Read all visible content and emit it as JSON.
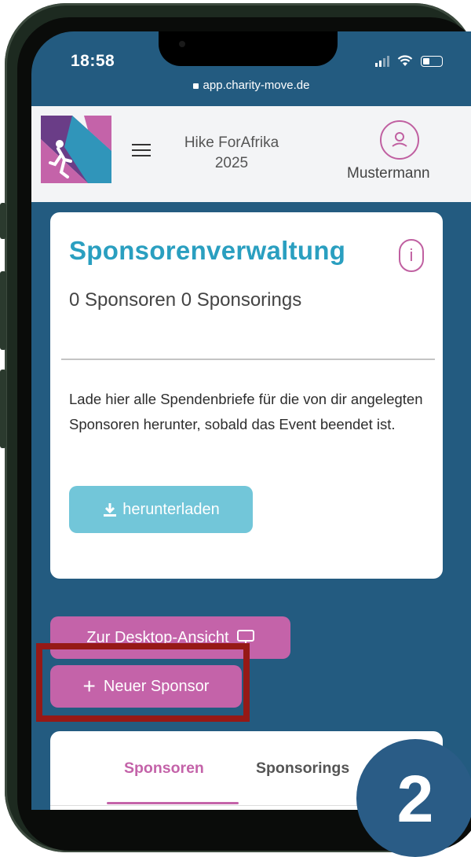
{
  "status_bar": {
    "time": "18:58"
  },
  "url_bar": {
    "url": "app.charity-move.de"
  },
  "header": {
    "event_title_line1": "Hike ForAfrika",
    "event_title_line2": "2025",
    "user_name": "Mustermann"
  },
  "card": {
    "title": "Sponsorenverwaltung",
    "info_icon_text": "i",
    "subtitle": "0 Sponsoren 0 Sponsorings",
    "description": "Lade hier alle Spendenbriefe für die von dir angelegten Sponsoren herunter, sobald das Event beendet ist.",
    "download_label": "herunterladen"
  },
  "actions": {
    "desktop_view_label": "Zur Desktop-Ansicht",
    "new_sponsor_label": "Neuer Sponsor",
    "new_sponsor_plus": "+"
  },
  "tabs": [
    {
      "label": "Sponsoren",
      "active": true
    },
    {
      "label": "Sponsorings",
      "active": false
    }
  ],
  "annotation": {
    "step_number": "2"
  },
  "colors": {
    "primary_pink": "#c463a9",
    "primary_blue": "#2a9fc0",
    "background_blue": "#235b80",
    "download_button": "#72c6d9",
    "highlight_red": "#961916"
  },
  "icons": [
    "lock-icon",
    "hamburger-icon",
    "user-icon",
    "info-icon",
    "download-icon",
    "monitor-icon",
    "plus-icon"
  ]
}
